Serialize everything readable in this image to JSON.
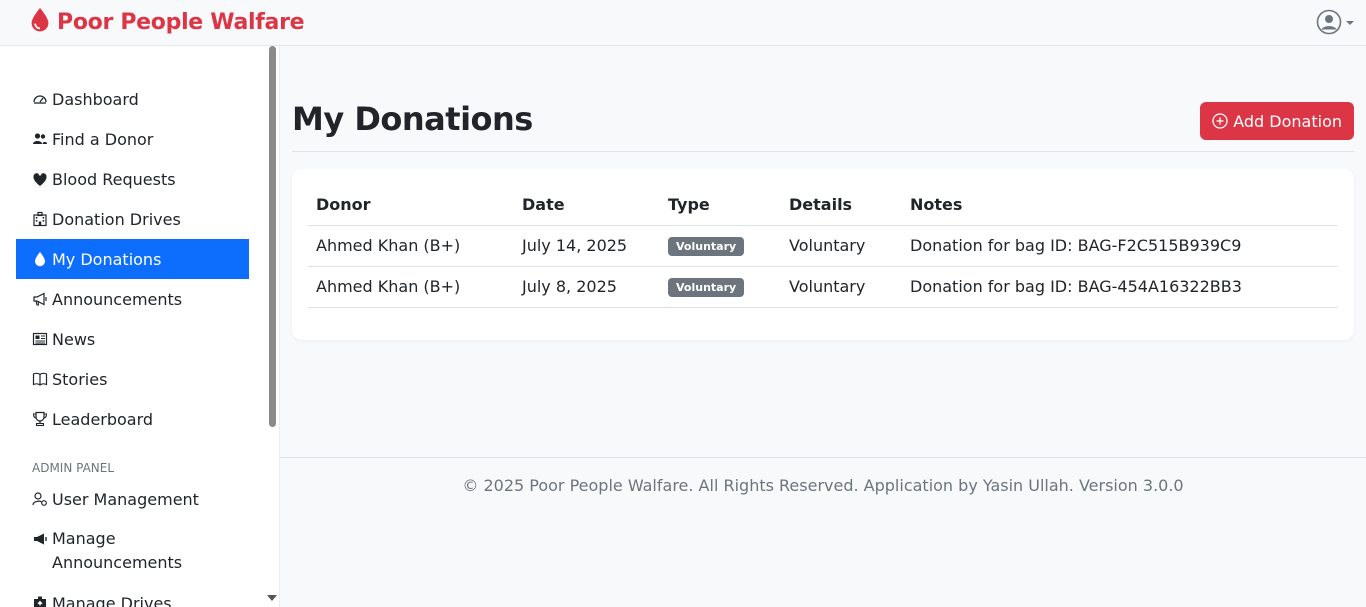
{
  "app": {
    "brand": "Poor People Walfare",
    "brand_color": "#dc3545",
    "accent_color": "#0d6efd"
  },
  "sidebar": {
    "items": [
      {
        "label": "Dashboard",
        "icon": "speedometer-icon"
      },
      {
        "label": "Find a Donor",
        "icon": "people-icon"
      },
      {
        "label": "Blood Requests",
        "icon": "heart-drop-icon"
      },
      {
        "label": "Donation Drives",
        "icon": "hospital-icon"
      },
      {
        "label": "My Donations",
        "icon": "droplet-icon",
        "active": true
      },
      {
        "label": "Announcements",
        "icon": "megaphone-icon"
      },
      {
        "label": "News",
        "icon": "newspaper-icon"
      },
      {
        "label": "Stories",
        "icon": "book-icon"
      },
      {
        "label": "Leaderboard",
        "icon": "trophy-icon"
      }
    ],
    "admin_heading": "ADMIN PANEL",
    "admin_items": [
      {
        "label": "User Management",
        "icon": "user-gear-icon"
      },
      {
        "label": "Manage Announcements",
        "icon": "megaphone-fill-icon"
      },
      {
        "label": "Manage Drives",
        "icon": "hospital-fill-icon"
      }
    ]
  },
  "main": {
    "title": "My Donations",
    "add_button": "Add Donation",
    "table": {
      "columns": [
        "Donor",
        "Date",
        "Type",
        "Details",
        "Notes"
      ],
      "rows": [
        {
          "donor": "Ahmed Khan (B+)",
          "date": "July 14, 2025",
          "type": "Voluntary",
          "details": "Voluntary",
          "notes": "Donation for bag ID: BAG-F2C515B939C9"
        },
        {
          "donor": "Ahmed Khan (B+)",
          "date": "July 8, 2025",
          "type": "Voluntary",
          "details": "Voluntary",
          "notes": "Donation for bag ID: BAG-454A16322BB3"
        }
      ]
    }
  },
  "footer": {
    "text": "© 2025 Poor People Walfare. All Rights Reserved. Application by Yasin Ullah. Version 3.0.0"
  }
}
